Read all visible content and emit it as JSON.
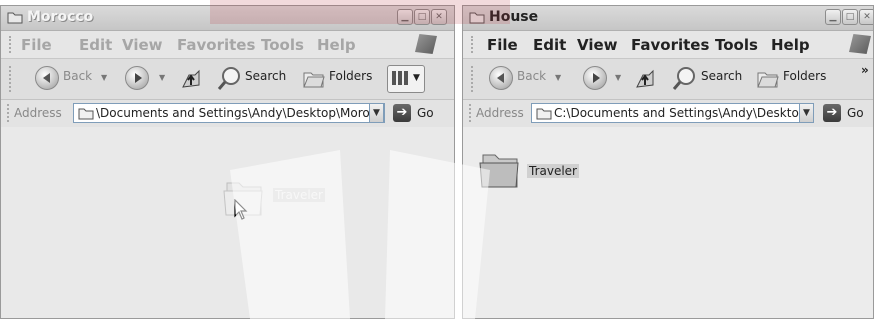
{
  "left_window": {
    "title": "Morocco",
    "menu": [
      "File",
      "Edit",
      "View",
      "Favorites",
      "Tools",
      "Help"
    ],
    "toolbar": {
      "back": "Back",
      "search": "Search",
      "folders": "Folders"
    },
    "address": {
      "label": "Address",
      "path": "\\Documents and Settings\\Andy\\Desktop\\Morocco",
      "go": "Go"
    },
    "items": [
      {
        "name": "Traveler",
        "icon": "folder-icon",
        "state": "being-dragged"
      }
    ]
  },
  "right_window": {
    "title": "House",
    "menu": [
      "File",
      "Edit",
      "View",
      "Favorites",
      "Tools",
      "Help"
    ],
    "toolbar": {
      "back": "Back",
      "search": "Search",
      "folders": "Folders",
      "overflow": "»"
    },
    "address": {
      "label": "Address",
      "path": "C:\\Documents and Settings\\Andy\\Desktop\\Ho",
      "go": "Go"
    },
    "items": [
      {
        "name": "Traveler",
        "icon": "folder-icon",
        "state": "selected"
      }
    ]
  },
  "colors": {
    "watermark": "#b8323c",
    "window_bg": "#e9e9e9"
  }
}
